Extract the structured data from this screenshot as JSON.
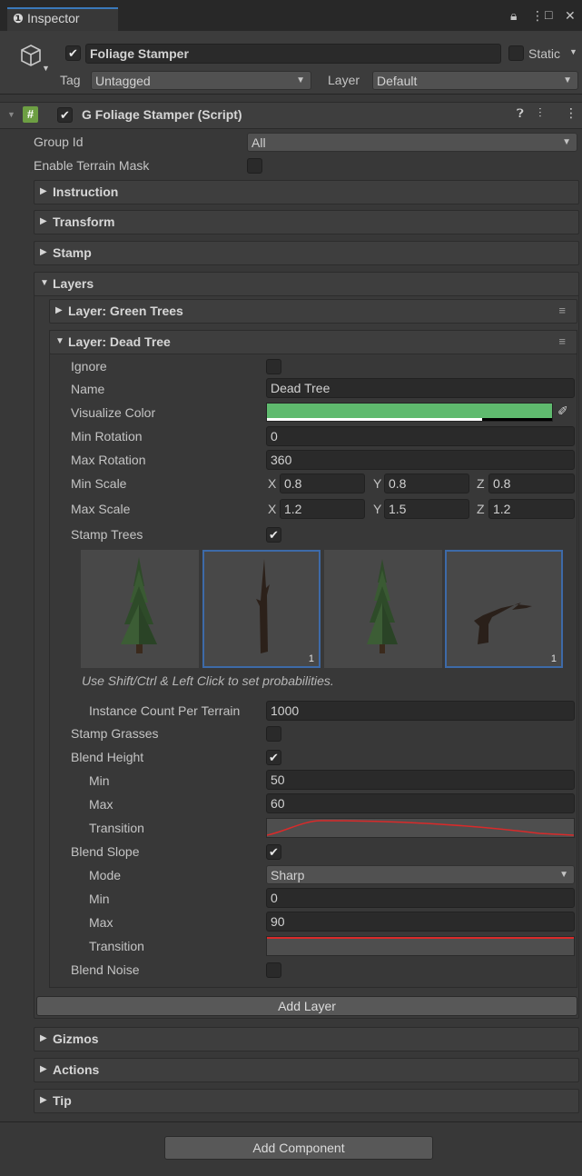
{
  "tab": {
    "icon": "info-icon",
    "title": "Inspector"
  },
  "object": {
    "active": true,
    "name": "Foliage Stamper",
    "static_label": "Static",
    "tag_label": "Tag",
    "tag_value": "Untagged",
    "layer_label": "Layer",
    "layer_value": "Default"
  },
  "component": {
    "enabled": true,
    "title": "G Foliage Stamper (Script)"
  },
  "fields": {
    "group_id_label": "Group Id",
    "group_id_value": "All",
    "enable_mask_label": "Enable Terrain Mask"
  },
  "sections": {
    "instruction": "Instruction",
    "transform": "Transform",
    "stamp": "Stamp",
    "layers": "Layers",
    "gizmos": "Gizmos",
    "actions": "Actions",
    "tip": "Tip"
  },
  "layers": {
    "green_trees": "Layer: Green Trees",
    "dead_tree": "Layer: Dead Tree"
  },
  "layer": {
    "ignore_label": "Ignore",
    "name_label": "Name",
    "name_value": "Dead Tree",
    "visualize_label": "Visualize Color",
    "visualize_color": "#5fba6e",
    "min_rot_label": "Min Rotation",
    "min_rot_value": "0",
    "max_rot_label": "Max Rotation",
    "max_rot_value": "360",
    "min_scale_label": "Min Scale",
    "min_scale": {
      "x": "0.8",
      "y": "0.8",
      "z": "0.8"
    },
    "max_scale_label": "Max Scale",
    "max_scale": {
      "x": "1.2",
      "y": "1.5",
      "z": "1.2"
    },
    "axis": {
      "x": "X",
      "y": "Y",
      "z": "Z"
    },
    "stamp_trees_label": "Stamp Trees",
    "tree_counts": {
      "t2": "1",
      "t4": "1"
    },
    "hint": "Use Shift/Ctrl & Left Click to set probabilities.",
    "instance_label": "Instance Count Per Terrain",
    "instance_value": "1000",
    "stamp_grasses_label": "Stamp Grasses",
    "blend_height_label": "Blend Height",
    "bh_min_label": "Min",
    "bh_min_value": "50",
    "bh_max_label": "Max",
    "bh_max_value": "60",
    "bh_transition_label": "Transition",
    "blend_slope_label": "Blend Slope",
    "bs_mode_label": "Mode",
    "bs_mode_value": "Sharp",
    "bs_min_label": "Min",
    "bs_min_value": "0",
    "bs_max_label": "Max",
    "bs_max_value": "90",
    "bs_transition_label": "Transition",
    "blend_noise_label": "Blend Noise"
  },
  "buttons": {
    "add_layer": "Add Layer",
    "add_component": "Add Component"
  }
}
